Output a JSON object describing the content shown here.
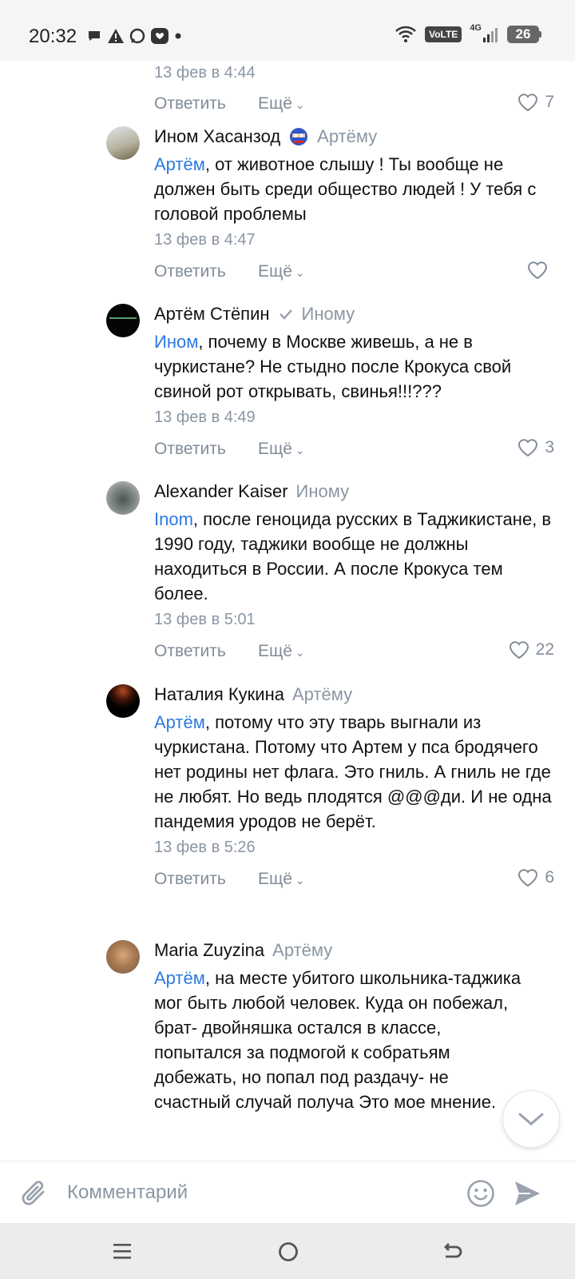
{
  "status_bar": {
    "time": "20:32",
    "network": "4G",
    "volte": "VoLTE",
    "battery": "26"
  },
  "partial_comment": {
    "time": "13 фев в 4:44",
    "reply_label": "Ответить",
    "more_label": "Ещё",
    "likes": "7"
  },
  "comments": [
    {
      "author": "Ином Хасанзод",
      "reply_to": "Артёму",
      "mention": "Артём",
      "text": ", от животное слышу ! Ты вообще не должен быть среди общество людей ! У тебя с головой проблемы",
      "time": "13 фев в 4:47",
      "reply_label": "Ответить",
      "more_label": "Ещё",
      "likes": ""
    },
    {
      "author": "Артём Стёпин",
      "reply_to": "Иному",
      "mention": "Ином",
      "text": ", почему в Москве живешь, а не в чуркистане? Не стыдно после Крокуса свой свиной рот открывать, свинья!!!???",
      "time": "13 фев в 4:49",
      "reply_label": "Ответить",
      "more_label": "Ещё",
      "likes": "3"
    },
    {
      "author": "Alexander Kaiser",
      "reply_to": "Иному",
      "mention": "Inom",
      "text": ", после геноцида русских в Таджикистане, в 1990 году, таджики вообще не должны находиться в России. А после Крокуса тем более.",
      "time": "13 фев в 5:01",
      "reply_label": "Ответить",
      "more_label": "Ещё",
      "likes": "22"
    },
    {
      "author": "Наталия Кукина",
      "reply_to": "Артёму",
      "mention": "Артём",
      "text": ", потому что эту тварь выгнали из чуркистана. Потому что Артем у пса бродячего нет родины нет флага. Это гниль. А гниль не где не любят. Но ведь плодятся @@@ди. И не одна пандемия уродов не берёт.",
      "time": "13 фев в 5:26",
      "reply_label": "Ответить",
      "more_label": "Ещё",
      "likes": "6"
    },
    {
      "author": "Maria Zuyzina",
      "reply_to": "Артёму",
      "mention": "Артём",
      "text": ", на месте убитого школьника-таджика мог быть любой человек. Куда он побежал, брат- двойняшка остался в классе, попытался за подмогой к собратьям добежать, но попал под раздачу- не счастный случай получа Это мое мнение.",
      "time": "",
      "reply_label": "",
      "more_label": "",
      "likes": ""
    }
  ],
  "composer": {
    "placeholder": "Комментарий"
  },
  "icons": {
    "attach": "paperclip-icon",
    "emoji": "smiley-icon",
    "send": "send-icon",
    "like": "heart-icon",
    "scroll": "chevron-down-icon"
  },
  "colors": {
    "mention": "#2a7ae2",
    "meta": "#8a96a3",
    "text": "#111111"
  }
}
